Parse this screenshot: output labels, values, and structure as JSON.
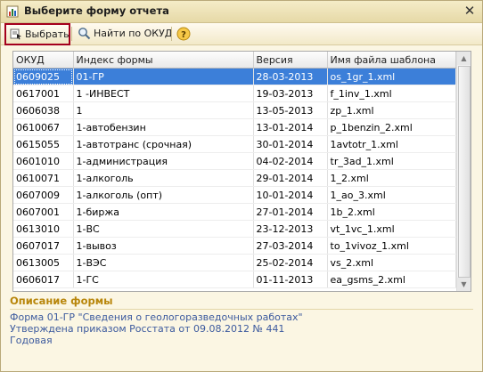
{
  "window": {
    "title": "Выберите форму отчета",
    "close_icon": "close-icon"
  },
  "toolbar": {
    "select_label": "Выбрать",
    "find_label": "Найти по ОКУД",
    "help_label": "?"
  },
  "table": {
    "headers": [
      "ОКУД",
      "Индекс формы",
      "Версия",
      "Имя файла шаблона"
    ],
    "rows": [
      [
        "0609025",
        "01-ГР",
        "28-03-2013",
        "os_1gr_1.xml"
      ],
      [
        "0617001",
        "1 -ИНВЕСТ",
        "19-03-2013",
        "f_1inv_1.xml"
      ],
      [
        "0606038",
        "1",
        "13-05-2013",
        "zp_1.xml"
      ],
      [
        "0610067",
        "1-автобензин",
        "13-01-2014",
        "p_1benzin_2.xml"
      ],
      [
        "0615055",
        "1-автотранс (срочная)",
        "30-01-2014",
        "1avtotr_1.xml"
      ],
      [
        "0601010",
        "1-администрация",
        "04-02-2014",
        "tr_3ad_1.xml"
      ],
      [
        "0610071",
        "1-алкоголь",
        "29-01-2014",
        "1_2.xml"
      ],
      [
        "0607009",
        "1-алкоголь (опт)",
        "10-01-2014",
        "1_ao_3.xml"
      ],
      [
        "0607001",
        "1-биржа",
        "27-01-2014",
        "1b_2.xml"
      ],
      [
        "0613010",
        "1-ВС",
        "23-12-2013",
        "vt_1vc_1.xml"
      ],
      [
        "0607017",
        "1-вывоз",
        "27-03-2014",
        "to_1vivoz_1.xml"
      ],
      [
        "0613005",
        "1-ВЭС",
        "25-02-2014",
        "vs_2.xml"
      ],
      [
        "0606017",
        "1-ГС",
        "01-11-2013",
        "ea_gsms_2.xml"
      ]
    ],
    "selected_index": 0
  },
  "description": {
    "title": "Описание формы",
    "lines": [
      "Форма 01-ГР \"Сведения о геологоразведочных работах\"",
      "Утверждена приказом Росстата от 09.08.2012 № 441",
      "Годовая"
    ]
  },
  "colors": {
    "selection": "#3c7fd9",
    "highlight_border": "#a4001d",
    "description_title": "#b8860b",
    "description_text": "#3c5a9e"
  }
}
